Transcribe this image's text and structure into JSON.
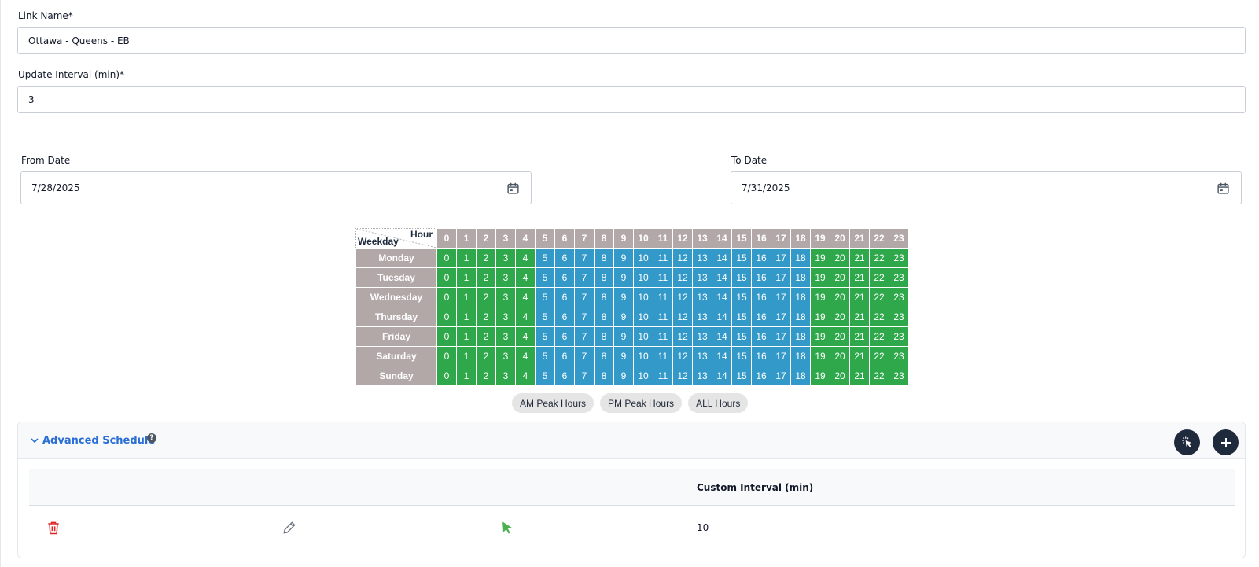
{
  "form": {
    "link_name_label": "Link Name*",
    "link_name_value": "Ottawa - Queens - EB",
    "update_interval_label": "Update Interval (min)*",
    "update_interval_value": "3",
    "from_date_label": "From Date",
    "from_date_value": "7/28/2025",
    "to_date_label": "To Date",
    "to_date_value": "7/31/2025"
  },
  "grid": {
    "hour_label": "Hour",
    "weekday_label": "Weekday",
    "hours": [
      "0",
      "1",
      "2",
      "3",
      "4",
      "5",
      "6",
      "7",
      "8",
      "9",
      "10",
      "11",
      "12",
      "13",
      "14",
      "15",
      "16",
      "17",
      "18",
      "19",
      "20",
      "21",
      "22",
      "23"
    ],
    "days": [
      "Monday",
      "Tuesday",
      "Wednesday",
      "Thursday",
      "Friday",
      "Saturday",
      "Sunday"
    ],
    "cell_state": [
      "green",
      "green",
      "green",
      "green",
      "green",
      "blue",
      "blue",
      "blue",
      "blue",
      "blue",
      "blue",
      "blue",
      "blue",
      "blue",
      "blue",
      "blue",
      "blue",
      "blue",
      "blue",
      "green",
      "green",
      "green",
      "green",
      "green"
    ],
    "colors": {
      "green": "#2ea84a",
      "blue": "#3399c9",
      "header": "#b3a8a8"
    }
  },
  "presets": {
    "am": "AM Peak Hours",
    "pm": "PM Peak Hours",
    "all": "ALL Hours"
  },
  "advanced": {
    "title": "Advanced Schedule",
    "help": "?",
    "column_custom_interval": "Custom Interval (min)",
    "rows": [
      {
        "custom_interval": "10"
      }
    ],
    "icons": {
      "collapse": "chevron-down-icon",
      "select": "cursor-click-icon",
      "add": "plus-icon",
      "delete": "trash-icon",
      "edit": "pencil-icon",
      "pointer": "cursor-arrow-icon"
    },
    "accent": "#2b6fd6",
    "delete_color": "#dc2626",
    "pointer_color": "#4caf50"
  }
}
